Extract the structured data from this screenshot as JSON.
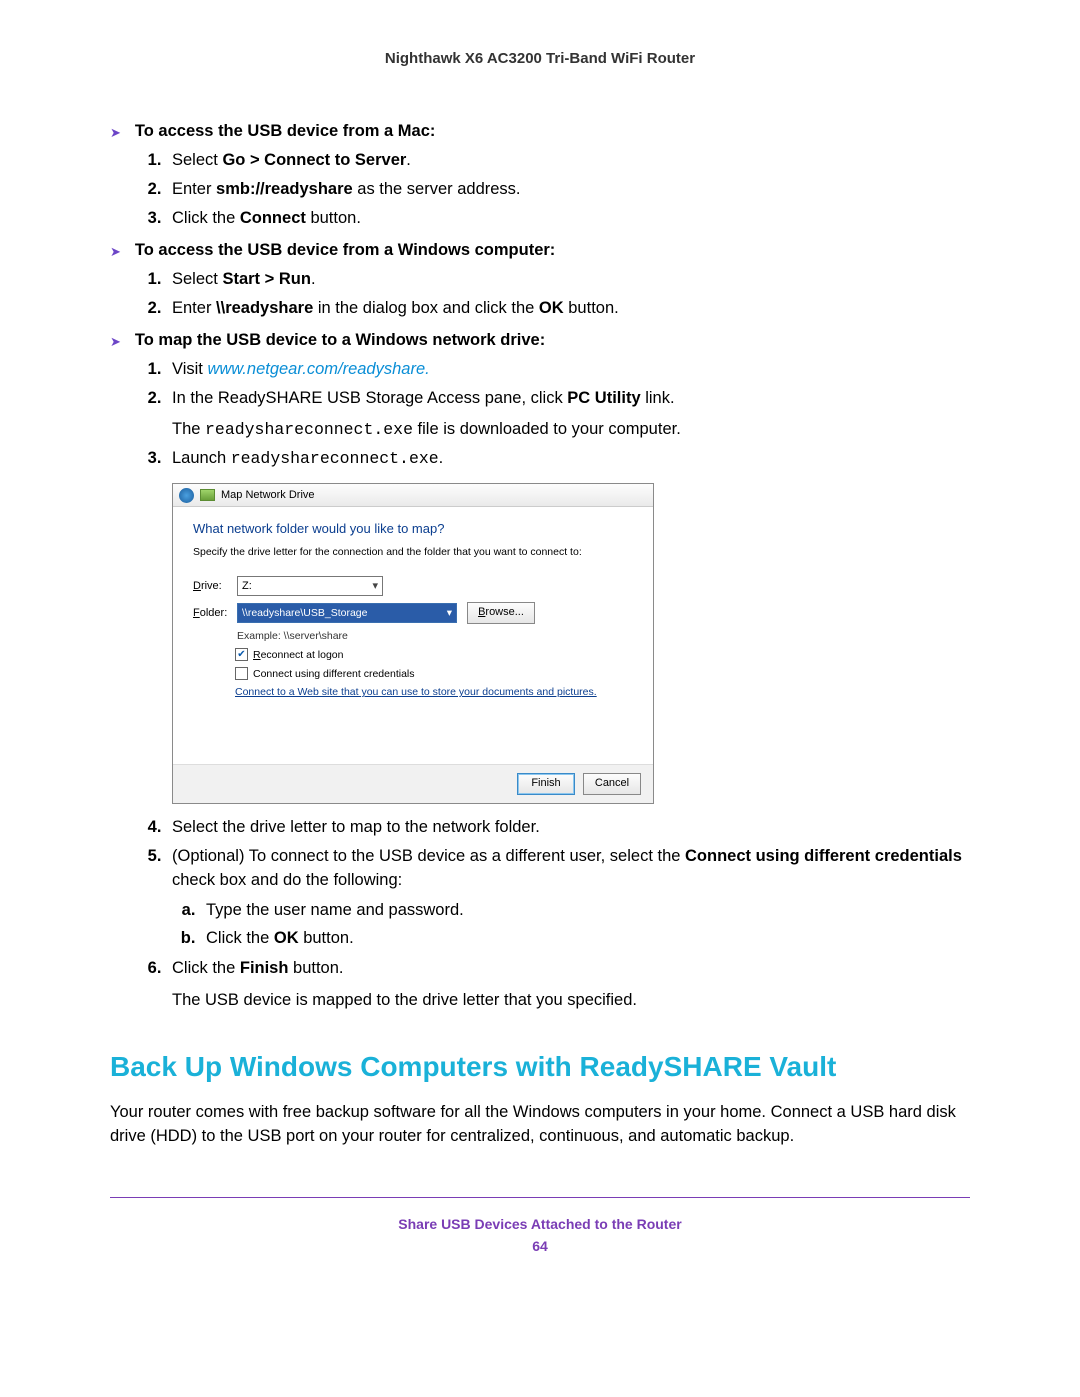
{
  "header": {
    "product": "Nighthawk X6 AC3200 Tri-Band WiFi Router"
  },
  "sec1": {
    "title": "To access the USB device from a Mac:",
    "s1a": "Select ",
    "s1b": "Go > Connect to Server",
    "s1c": ".",
    "s2a": "Enter ",
    "s2b": "smb://readyshare",
    "s2c": " as the server address.",
    "s3a": "Click the ",
    "s3b": "Connect",
    "s3c": " button."
  },
  "sec2": {
    "title": "To access the USB device from a Windows computer:",
    "s1a": "Select ",
    "s1b": "Start > Run",
    "s1c": ".",
    "s2a": "Enter ",
    "s2b": "\\\\readyshare",
    "s2c": " in the dialog box and click the ",
    "s2d": "OK",
    "s2e": " button."
  },
  "sec3": {
    "title": "To map the USB device to a Windows network drive:",
    "s1a": "Visit ",
    "s1b": "www.netgear.com/readyshare.",
    "s2a": "In the ReadySHARE USB Storage Access pane, click ",
    "s2b": "PC Utility",
    "s2c": " link.",
    "s2note_a": "The ",
    "s2note_b": "readyshareconnect.exe",
    "s2note_c": " file is downloaded to your computer.",
    "s3a": "Launch ",
    "s3b": "readyshareconnect.exe",
    "s3c": ".",
    "s4": "Select the drive letter to map to the network folder.",
    "s5a": "(Optional) To connect to the USB device as a different user, select the ",
    "s5b": "Connect using different credentials",
    "s5c": " check box and do the following:",
    "s5_a": "Type the user name and password.",
    "s5_b1": "Click the ",
    "s5_b2": "OK",
    "s5_b3": " button.",
    "s6a": "Click the ",
    "s6b": "Finish",
    "s6c": " button.",
    "s6note": "The USB device is mapped to the drive letter that you specified."
  },
  "dialog": {
    "title": "Map Network Drive",
    "heading": "What network folder would you like to map?",
    "sub": "Specify the drive letter for the connection and the folder that you want to connect to:",
    "drive_label_u": "D",
    "drive_label_r": "rive:",
    "folder_label_u": "F",
    "folder_label_r": "older:",
    "drive_value": "Z:",
    "folder_value": "\\\\readyshare\\USB_Storage",
    "browse": "Browse...",
    "example": "Example: \\\\server\\share",
    "reconnect_u": "R",
    "reconnect_r": "econnect at logon",
    "diffcred": "Connect using different credentials",
    "weblink": "Connect to a Web site that you can use to store your documents and pictures.",
    "finish": "Finish",
    "cancel": "Cancel"
  },
  "h2": "Back Up Windows Computers with ReadySHARE Vault",
  "para1": "Your router comes with free backup software for all the Windows computers in your home. Connect a USB hard disk drive (HDD) to the USB port on your router for centralized, continuous, and automatic backup.",
  "footer": {
    "chapter": "Share USB Devices Attached to the Router",
    "page": "64"
  }
}
